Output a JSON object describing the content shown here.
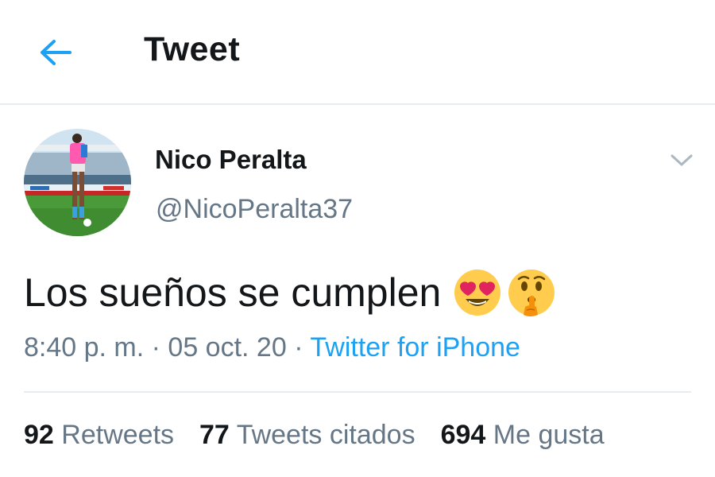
{
  "header": {
    "title": "Tweet",
    "back_icon": "arrow-left-icon",
    "accent_color": "#1da1f2"
  },
  "author": {
    "display_name": "Nico Peralta",
    "handle": "@NicoPeralta37",
    "avatar_icon": "profile-photo-soccer-player"
  },
  "tweet": {
    "text": "Los sueños se cumplen",
    "emojis": [
      "heart-eyes-emoji",
      "shushing-face-emoji"
    ]
  },
  "meta": {
    "time": "8:40 p. m.",
    "separator": " · ",
    "date": "05 oct. 20",
    "source": "Twitter for iPhone"
  },
  "stats": {
    "retweets_count": "92",
    "retweets_label": "Retweets",
    "quotes_count": "77",
    "quotes_label": "Tweets citados",
    "likes_count": "694",
    "likes_label": "Me gusta"
  },
  "colors": {
    "text": "#14171a",
    "secondary": "#657786",
    "link": "#1da1f2",
    "divider": "#e6ecf0"
  }
}
